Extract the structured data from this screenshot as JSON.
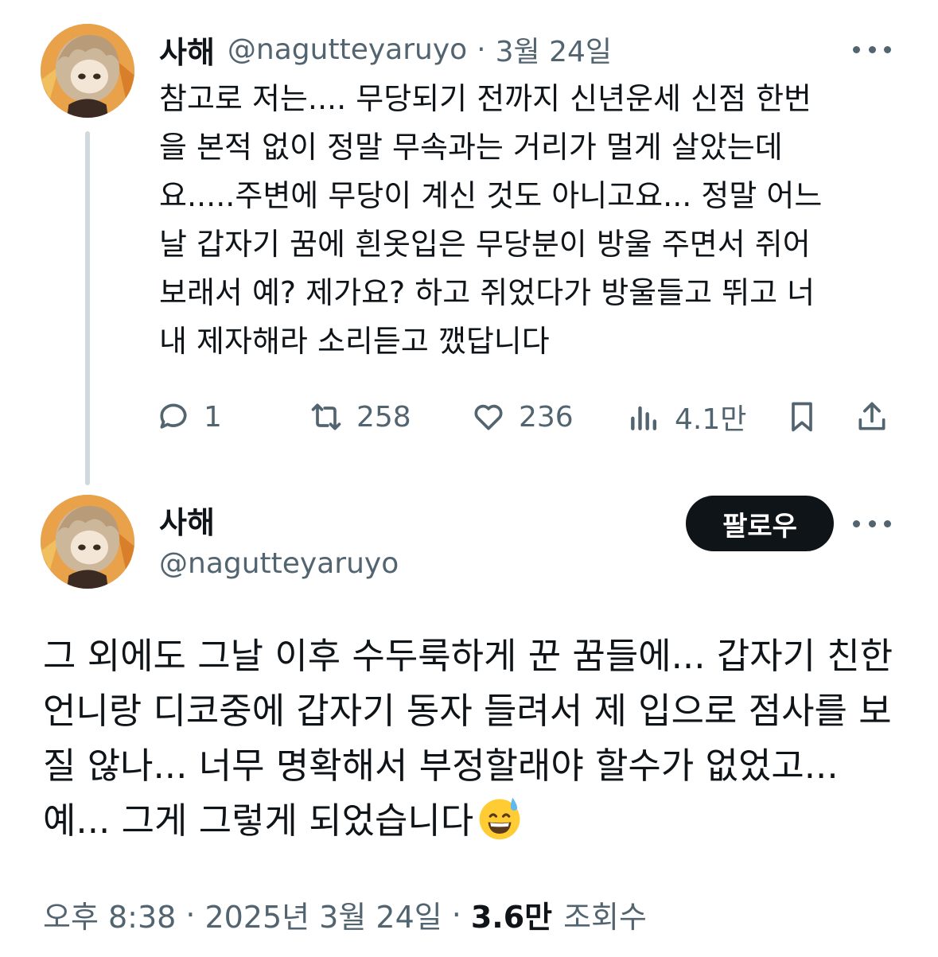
{
  "tweet1": {
    "name": "사해",
    "handle": "@nagutteyaruyo",
    "separator": "·",
    "date": "3월 24일",
    "body": "참고로 저는.... 무당되기 전까지 신년운세 신점 한번\n을 본적 없이 정말 무속과는 거리가 멀게 살았는데\n요.....주변에 무당이 계신 것도 아니고요... 정말 어느\n날 갑자기 꿈에 흰옷입은 무당분이 방울 주면서 쥐어\n보래서 예? 제가요? 하고 쥐었다가 방울들고 뛰고 너\n내 제자해라 소리듣고 깼답니다",
    "replies": "1",
    "retweets": "258",
    "likes": "236",
    "views": "4.1만"
  },
  "tweet2": {
    "name": "사해",
    "handle": "@nagutteyaruyo",
    "follow_label": "팔로우",
    "body": "그 외에도 그날 이후 수두룩하게 꾼 꿈들에... 갑자기 친한언니랑 디코중에 갑자기 동자 들려서 제 입으로 점사를 보질 않나... 너무 명확해서 부정할래야 할수가 없었고... 예... 그게 그렇게 되었습니다",
    "emoji": "grinning-face-with-sweat-icon",
    "time": "오후 8:38",
    "separator": "·",
    "date": "2025년 3월 24일",
    "views_count": "3.6만",
    "views_label": "조회수"
  },
  "colors": {
    "text": "#0f1419",
    "secondary": "#536471",
    "thread_line": "#cfd9de",
    "button_bg": "#0f1419",
    "button_text": "#ffffff"
  }
}
